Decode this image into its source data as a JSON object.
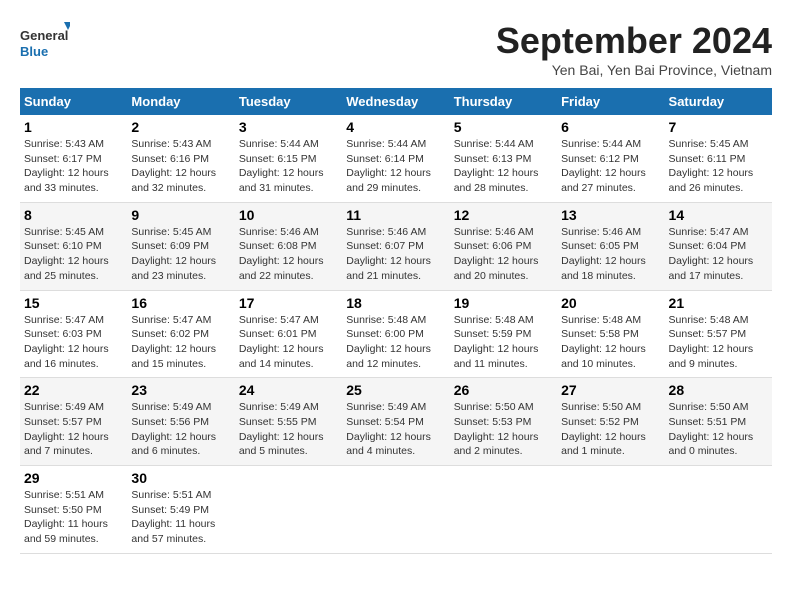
{
  "logo": {
    "line1": "General",
    "line2": "Blue"
  },
  "title": "September 2024",
  "location": "Yen Bai, Yen Bai Province, Vietnam",
  "headers": [
    "Sunday",
    "Monday",
    "Tuesday",
    "Wednesday",
    "Thursday",
    "Friday",
    "Saturday"
  ],
  "weeks": [
    [
      {
        "day": "1",
        "info": "Sunrise: 5:43 AM\nSunset: 6:17 PM\nDaylight: 12 hours and 33 minutes."
      },
      {
        "day": "2",
        "info": "Sunrise: 5:43 AM\nSunset: 6:16 PM\nDaylight: 12 hours and 32 minutes."
      },
      {
        "day": "3",
        "info": "Sunrise: 5:44 AM\nSunset: 6:15 PM\nDaylight: 12 hours and 31 minutes."
      },
      {
        "day": "4",
        "info": "Sunrise: 5:44 AM\nSunset: 6:14 PM\nDaylight: 12 hours and 29 minutes."
      },
      {
        "day": "5",
        "info": "Sunrise: 5:44 AM\nSunset: 6:13 PM\nDaylight: 12 hours and 28 minutes."
      },
      {
        "day": "6",
        "info": "Sunrise: 5:44 AM\nSunset: 6:12 PM\nDaylight: 12 hours and 27 minutes."
      },
      {
        "day": "7",
        "info": "Sunrise: 5:45 AM\nSunset: 6:11 PM\nDaylight: 12 hours and 26 minutes."
      }
    ],
    [
      {
        "day": "8",
        "info": "Sunrise: 5:45 AM\nSunset: 6:10 PM\nDaylight: 12 hours and 25 minutes."
      },
      {
        "day": "9",
        "info": "Sunrise: 5:45 AM\nSunset: 6:09 PM\nDaylight: 12 hours and 23 minutes."
      },
      {
        "day": "10",
        "info": "Sunrise: 5:46 AM\nSunset: 6:08 PM\nDaylight: 12 hours and 22 minutes."
      },
      {
        "day": "11",
        "info": "Sunrise: 5:46 AM\nSunset: 6:07 PM\nDaylight: 12 hours and 21 minutes."
      },
      {
        "day": "12",
        "info": "Sunrise: 5:46 AM\nSunset: 6:06 PM\nDaylight: 12 hours and 20 minutes."
      },
      {
        "day": "13",
        "info": "Sunrise: 5:46 AM\nSunset: 6:05 PM\nDaylight: 12 hours and 18 minutes."
      },
      {
        "day": "14",
        "info": "Sunrise: 5:47 AM\nSunset: 6:04 PM\nDaylight: 12 hours and 17 minutes."
      }
    ],
    [
      {
        "day": "15",
        "info": "Sunrise: 5:47 AM\nSunset: 6:03 PM\nDaylight: 12 hours and 16 minutes."
      },
      {
        "day": "16",
        "info": "Sunrise: 5:47 AM\nSunset: 6:02 PM\nDaylight: 12 hours and 15 minutes."
      },
      {
        "day": "17",
        "info": "Sunrise: 5:47 AM\nSunset: 6:01 PM\nDaylight: 12 hours and 14 minutes."
      },
      {
        "day": "18",
        "info": "Sunrise: 5:48 AM\nSunset: 6:00 PM\nDaylight: 12 hours and 12 minutes."
      },
      {
        "day": "19",
        "info": "Sunrise: 5:48 AM\nSunset: 5:59 PM\nDaylight: 12 hours and 11 minutes."
      },
      {
        "day": "20",
        "info": "Sunrise: 5:48 AM\nSunset: 5:58 PM\nDaylight: 12 hours and 10 minutes."
      },
      {
        "day": "21",
        "info": "Sunrise: 5:48 AM\nSunset: 5:57 PM\nDaylight: 12 hours and 9 minutes."
      }
    ],
    [
      {
        "day": "22",
        "info": "Sunrise: 5:49 AM\nSunset: 5:57 PM\nDaylight: 12 hours and 7 minutes."
      },
      {
        "day": "23",
        "info": "Sunrise: 5:49 AM\nSunset: 5:56 PM\nDaylight: 12 hours and 6 minutes."
      },
      {
        "day": "24",
        "info": "Sunrise: 5:49 AM\nSunset: 5:55 PM\nDaylight: 12 hours and 5 minutes."
      },
      {
        "day": "25",
        "info": "Sunrise: 5:49 AM\nSunset: 5:54 PM\nDaylight: 12 hours and 4 minutes."
      },
      {
        "day": "26",
        "info": "Sunrise: 5:50 AM\nSunset: 5:53 PM\nDaylight: 12 hours and 2 minutes."
      },
      {
        "day": "27",
        "info": "Sunrise: 5:50 AM\nSunset: 5:52 PM\nDaylight: 12 hours and 1 minute."
      },
      {
        "day": "28",
        "info": "Sunrise: 5:50 AM\nSunset: 5:51 PM\nDaylight: 12 hours and 0 minutes."
      }
    ],
    [
      {
        "day": "29",
        "info": "Sunrise: 5:51 AM\nSunset: 5:50 PM\nDaylight: 11 hours and 59 minutes."
      },
      {
        "day": "30",
        "info": "Sunrise: 5:51 AM\nSunset: 5:49 PM\nDaylight: 11 hours and 57 minutes."
      },
      {
        "day": "",
        "info": ""
      },
      {
        "day": "",
        "info": ""
      },
      {
        "day": "",
        "info": ""
      },
      {
        "day": "",
        "info": ""
      },
      {
        "day": "",
        "info": ""
      }
    ]
  ]
}
